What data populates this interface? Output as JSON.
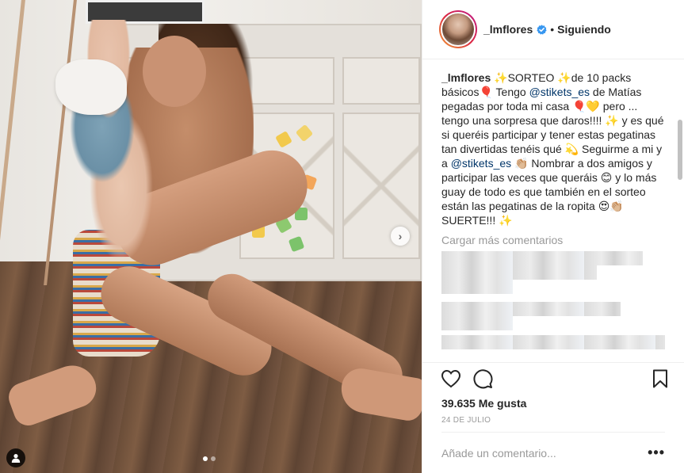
{
  "post": {
    "username": "_lmflores",
    "follow_separator": "•",
    "follow_state": "Siguiendo",
    "caption": {
      "username": "_lmflores",
      "line1": " ✨SORTEO ✨de 10 packs básicos🎈 Tengo ",
      "mention1": "@stikets_es",
      "line2": " de Matías pegadas por toda mi casa 🎈💛 pero ... tengo una sorpresa que daros!!!! ✨ y es qué si queréis participar y tener estas pegatinas tan divertidas tenéis qué 💫 Seguirme a mi y a ",
      "mention2": "@stikets_es",
      "line3": " 👏🏼 Nombrar a dos amigos y participar las veces que queráis 😊 y lo más guay de todo es que también en el sorteo están las pegatinas de la ropita 😍👏🏼 SUERTE!!! ✨"
    },
    "load_more_label": "Cargar más comentarios",
    "likes_label": "39.635 Me gusta",
    "date_label": "24 DE JULIO",
    "comment_placeholder": "Añade un comentario...",
    "more_label": "•••",
    "carousel_next_label": "›"
  },
  "icons": {
    "verified": "verified-badge-icon",
    "like": "heart-icon",
    "comment": "speech-bubble-icon",
    "save": "bookmark-icon",
    "user_tag": "person-icon"
  },
  "colors": {
    "verified": "#3897f0",
    "mention": "#003569",
    "muted": "#999999",
    "text": "#262626"
  },
  "carousel": {
    "total": 2,
    "active": 1
  }
}
